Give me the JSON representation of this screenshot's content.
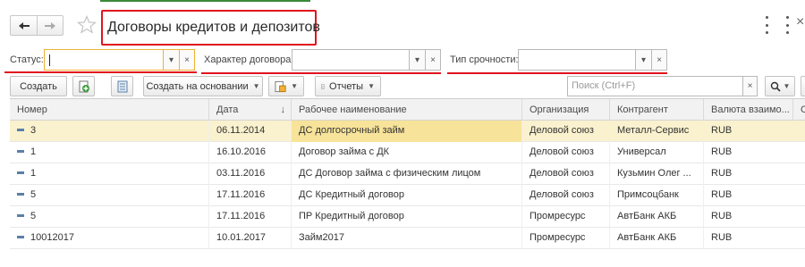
{
  "window": {
    "title": "Договоры кредитов и депозитов"
  },
  "filters": {
    "status": {
      "label": "Статус:",
      "value": ""
    },
    "contract_type": {
      "label": "Характер договора:",
      "value": ""
    },
    "term_type": {
      "label": "Тип срочности:",
      "value": ""
    }
  },
  "toolbar": {
    "create_label": "Создать",
    "create_based_label": "Создать на основании",
    "reports_label": "Отчеты",
    "search_placeholder": "Поиск (Ctrl+F)"
  },
  "table": {
    "columns": [
      "Номер",
      "Дата",
      "Рабочее наименование",
      "Организация",
      "Контрагент",
      "Валюта взаимо...",
      "С"
    ],
    "sort_indicator": "↓",
    "rows": [
      {
        "number": "3",
        "date": "06.11.2014",
        "name": "ДС долгосрочный займ",
        "org": "Деловой союз",
        "counterparty": "Металл-Сервис",
        "currency": "RUB"
      },
      {
        "number": "1",
        "date": "16.10.2016",
        "name": "Договор займа с ДК",
        "org": "Деловой союз",
        "counterparty": "Универсал",
        "currency": "RUB"
      },
      {
        "number": "1",
        "date": "03.11.2016",
        "name": "ДС Договор займа с физическим лицом",
        "org": "Деловой союз",
        "counterparty": "Кузьмин Олег ...",
        "currency": "RUB"
      },
      {
        "number": "5",
        "date": "17.11.2016",
        "name": "ДС Кредитный договор",
        "org": "Деловой союз",
        "counterparty": "Примсоцбанк",
        "currency": "RUB"
      },
      {
        "number": "5",
        "date": "17.11.2016",
        "name": "ПР Кредитный договор",
        "org": "Промресурс",
        "counterparty": "АвтБанк АКБ",
        "currency": "RUB"
      },
      {
        "number": "10012017",
        "date": "10.01.2017",
        "name": "Займ2017",
        "org": "Промресурс",
        "counterparty": "АвтБанк АКБ",
        "currency": "RUB"
      }
    ]
  },
  "colors": {
    "highlight_red": "#e0141e",
    "selected_row": "#faf1ce",
    "selected_cell": "#f7e39a",
    "active_field_border": "#f0b132"
  },
  "icons": [
    "back-arrow-icon",
    "forward-arrow-icon",
    "favorite-star-icon",
    "add-copy-icon",
    "list-icon",
    "document-fill-icon",
    "search-icon",
    "more-menu-icon",
    "close-icon",
    "document-row-icon"
  ]
}
